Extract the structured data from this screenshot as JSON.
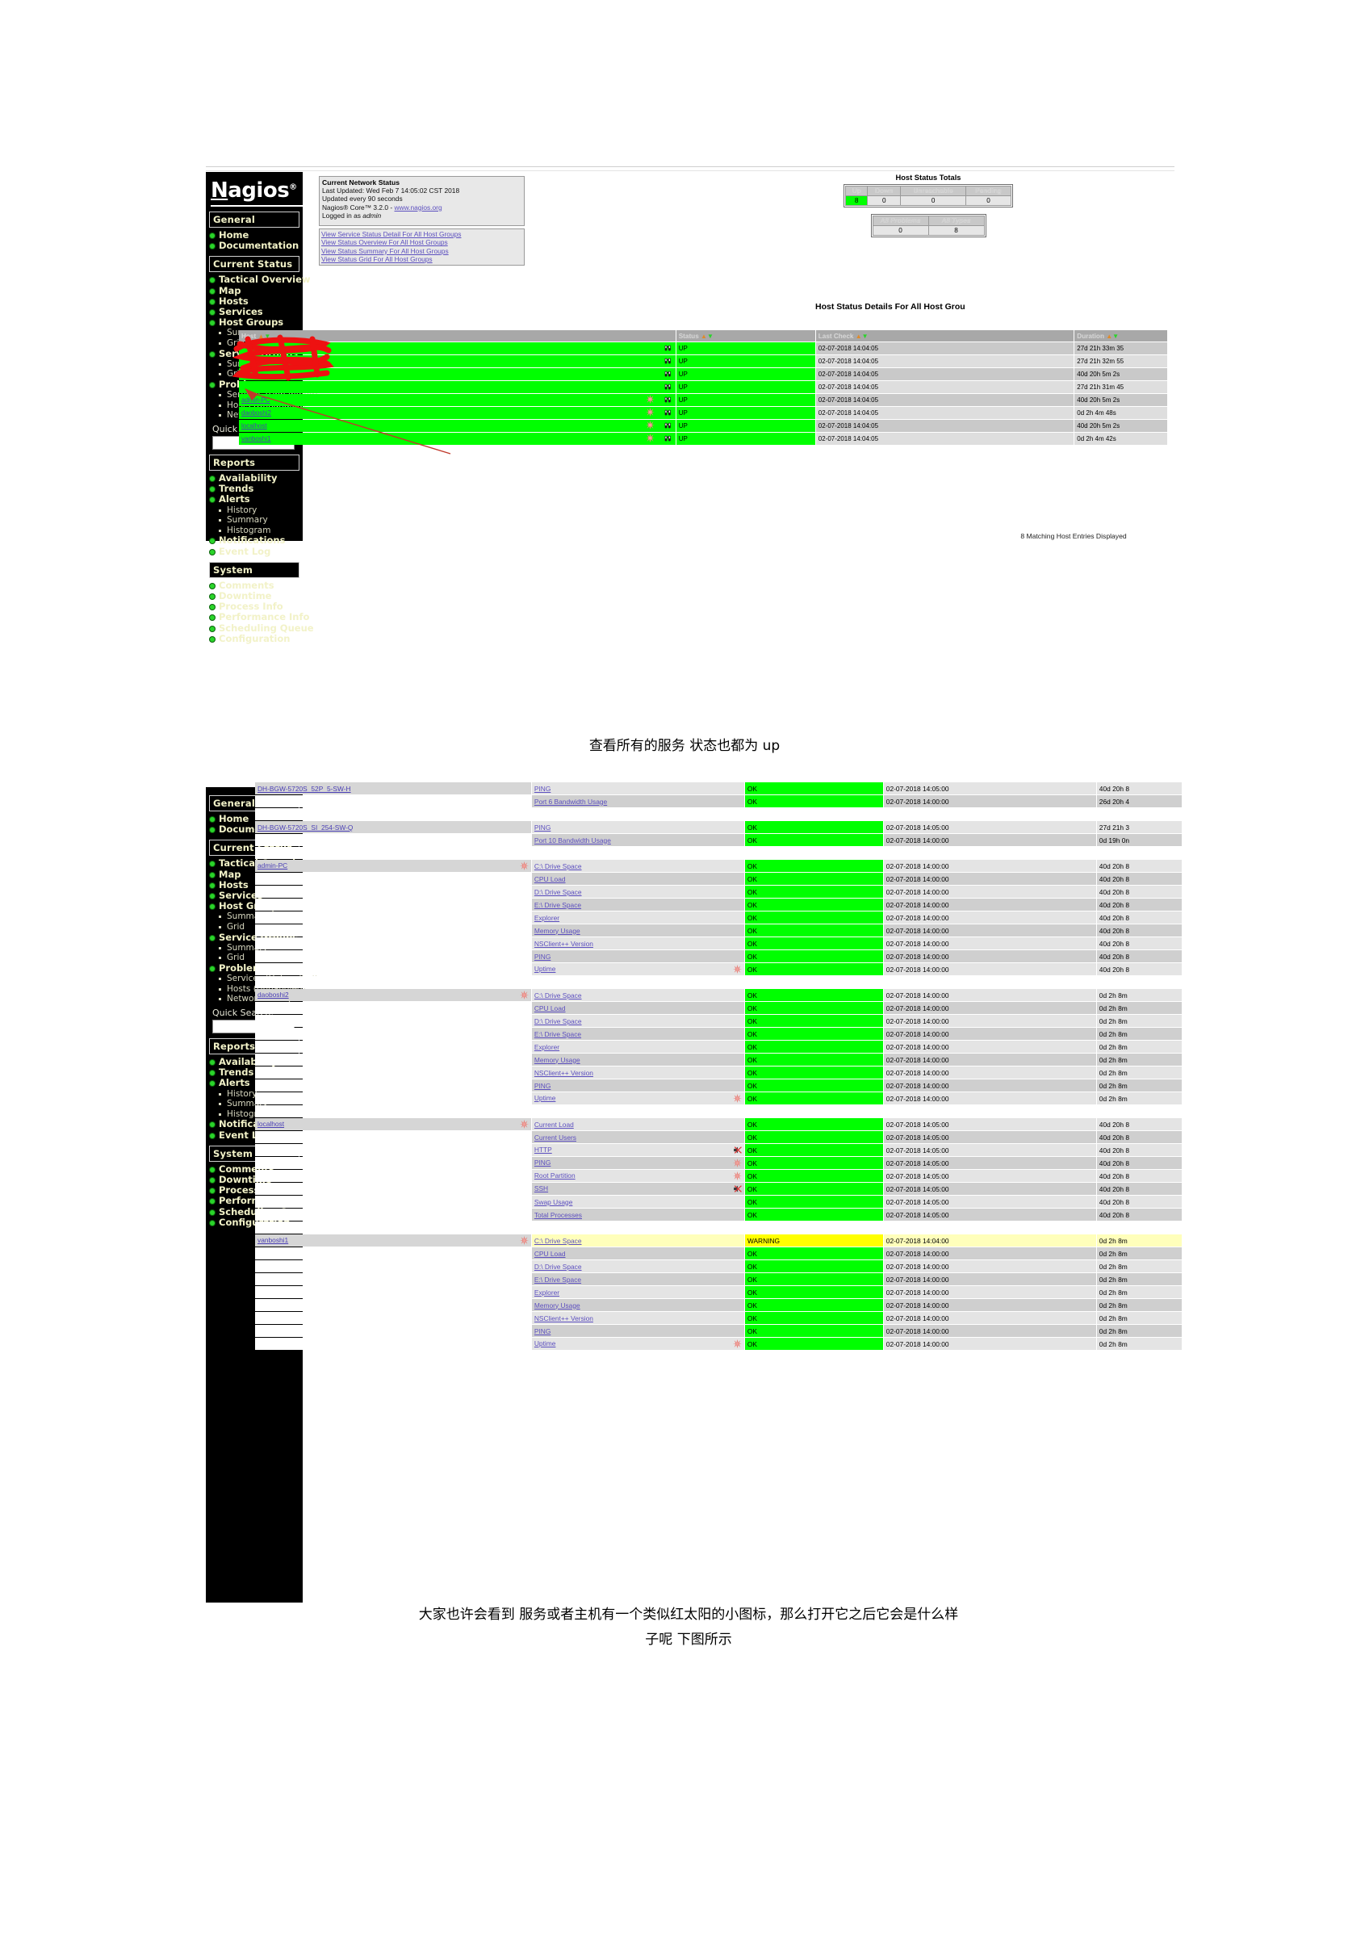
{
  "page": {
    "caption_mid": "查看所有的服务  状态也都为 up",
    "caption_bottom_line1": "大家也许会看到  服务或者主机有一个类似红太阳的小图标，那么打开它之后它会是什么样",
    "caption_bottom_line2": "子呢  下图所示"
  },
  "brand": {
    "logo_first": "N",
    "logo_rest": "agios",
    "logo_reg": "®"
  },
  "sidebar": {
    "sections": [
      {
        "title": "General",
        "items": [
          {
            "label": "Home",
            "children": []
          },
          {
            "label": "Documentation",
            "children": []
          }
        ]
      },
      {
        "title": "Current Status",
        "items": [
          {
            "label": "Tactical Overview",
            "children": []
          },
          {
            "label": "Map",
            "children": []
          },
          {
            "label": "Hosts",
            "children": []
          },
          {
            "label": "Services",
            "children": []
          },
          {
            "label": "Host Groups",
            "children": [
              "Summary",
              "Grid"
            ]
          },
          {
            "label": "Service Groups",
            "children": [
              "Summary",
              "Grid"
            ]
          },
          {
            "label": "Problems",
            "children": [
              "Services (Unhandled)",
              "Hosts (Unhandled)",
              "Network Outages"
            ]
          }
        ],
        "quick_search_label": "Quick Search:",
        "quick_search_value": ""
      },
      {
        "title": "Reports",
        "items": [
          {
            "label": "Availability",
            "children": []
          },
          {
            "label": "Trends",
            "children": []
          },
          {
            "label": "Alerts",
            "children": [
              "History",
              "Summary",
              "Histogram"
            ]
          },
          {
            "label": "Notifications",
            "children": []
          },
          {
            "label": "Event Log",
            "children": []
          }
        ]
      },
      {
        "title": "System",
        "items": [
          {
            "label": "Comments",
            "children": []
          },
          {
            "label": "Downtime",
            "children": []
          },
          {
            "label": "Process Info",
            "children": []
          },
          {
            "label": "Performance Info",
            "children": []
          },
          {
            "label": "Scheduling Queue",
            "children": []
          },
          {
            "label": "Configuration",
            "children": []
          }
        ]
      }
    ]
  },
  "network_status": {
    "title": "Current Network Status",
    "last_updated": "Last Updated: Wed Feb 7 14:05:02 CST 2018",
    "update_interval": "Updated every 90 seconds",
    "version_prefix": "Nagios® Core™ 3.2.0 - ",
    "version_link": "www.nagios.org",
    "logged_in": "Logged in as ",
    "logged_in_user": "admin",
    "links": [
      "View Service Status Detail For All Host Groups",
      "View Status Overview For All Host Groups",
      "View Status Summary For All Host Groups",
      "View Status Grid For All Host Groups"
    ]
  },
  "host_totals": {
    "title": "Host Status Totals",
    "headers": [
      "Up",
      "Down",
      "Unreachable",
      "Pending"
    ],
    "values": [
      "8",
      "0",
      "0",
      "0"
    ],
    "summary_headers": [
      "All Problems",
      "All Types"
    ],
    "summary_values": [
      "0",
      "8"
    ]
  },
  "host_details": {
    "title": "Host Status Details For All Host Grou",
    "columns": [
      "Host",
      "Status",
      "Last Check",
      "Duration"
    ],
    "rows": [
      {
        "host": "",
        "redacted": true,
        "status": "UP",
        "last_check": "02-07-2018 14:04:05",
        "duration": "27d 21h 33m 35",
        "sun": false
      },
      {
        "host": "",
        "redacted": true,
        "status": "UP",
        "last_check": "02-07-2018 14:04:05",
        "duration": "27d 21h 32m 55",
        "sun": false
      },
      {
        "host": "",
        "redacted": true,
        "status": "UP",
        "last_check": "02-07-2018 14:04:05",
        "duration": "40d 20h 5m 2s",
        "sun": false
      },
      {
        "host": "",
        "redacted": true,
        "status": "UP",
        "last_check": "02-07-2018 14:04:05",
        "duration": "27d 21h 31m 45",
        "sun": false
      },
      {
        "host": "admin-PC",
        "redacted": false,
        "status": "UP",
        "last_check": "02-07-2018 14:04:05",
        "duration": "40d 20h 5m 2s",
        "sun": true
      },
      {
        "host": "daoboshi2",
        "redacted": false,
        "status": "UP",
        "last_check": "02-07-2018 14:04:05",
        "duration": "0d 2h 4m 48s",
        "sun": true
      },
      {
        "host": "localhost",
        "redacted": false,
        "status": "UP",
        "last_check": "02-07-2018 14:04:05",
        "duration": "40d 20h 5m 2s",
        "sun": true
      },
      {
        "host": "vanboshi1",
        "redacted": false,
        "status": "UP",
        "last_check": "02-07-2018 14:04:05",
        "duration": "0d 2h 4m 42s",
        "sun": true
      }
    ],
    "footer": "8 Matching Host Entries Displayed"
  },
  "service_details": {
    "groups": [
      {
        "host": "DH-BGW-5720S_52P_5-SW-H",
        "host_sun": false,
        "partial_top": true,
        "services": [
          {
            "name": "PING",
            "status": "OK",
            "last_check": "02-07-2018 14:05:00",
            "duration": "40d 20h 8",
            "icon": ""
          },
          {
            "name": "Port 6 Bandwidth Usage",
            "status": "OK",
            "last_check": "02-07-2018 14:00:00",
            "duration": "26d 20h 4",
            "icon": ""
          }
        ]
      },
      {
        "host": "DH-BGW-5720S_SI_254-SW-Q",
        "host_sun": false,
        "partial_top": false,
        "services": [
          {
            "name": "PING",
            "status": "OK",
            "last_check": "02-07-2018 14:05:00",
            "duration": "27d 21h 3",
            "icon": ""
          },
          {
            "name": "Port 10 Bandwidth Usage",
            "status": "OK",
            "last_check": "02-07-2018 14:00:00",
            "duration": "0d 19h 0n",
            "icon": ""
          }
        ]
      },
      {
        "host": "admin-PC",
        "host_sun": true,
        "partial_top": false,
        "services": [
          {
            "name": "C:\\ Drive Space",
            "status": "OK",
            "last_check": "02-07-2018 14:00:00",
            "duration": "40d 20h 8",
            "icon": ""
          },
          {
            "name": "CPU Load",
            "status": "OK",
            "last_check": "02-07-2018 14:00:00",
            "duration": "40d 20h 8",
            "icon": ""
          },
          {
            "name": "D:\\ Drive Space",
            "status": "OK",
            "last_check": "02-07-2018 14:00:00",
            "duration": "40d 20h 8",
            "icon": ""
          },
          {
            "name": "E:\\ Drive Space",
            "status": "OK",
            "last_check": "02-07-2018 14:00:00",
            "duration": "40d 20h 8",
            "icon": ""
          },
          {
            "name": "Explorer",
            "status": "OK",
            "last_check": "02-07-2018 14:00:00",
            "duration": "40d 20h 8",
            "icon": ""
          },
          {
            "name": "Memory Usage",
            "status": "OK",
            "last_check": "02-07-2018 14:00:00",
            "duration": "40d 20h 8",
            "icon": ""
          },
          {
            "name": "NSClient++ Version",
            "status": "OK",
            "last_check": "02-07-2018 14:00:00",
            "duration": "40d 20h 8",
            "icon": ""
          },
          {
            "name": "PING",
            "status": "OK",
            "last_check": "02-07-2018 14:00:00",
            "duration": "40d 20h 8",
            "icon": ""
          },
          {
            "name": "Uptime",
            "status": "OK",
            "last_check": "02-07-2018 14:00:00",
            "duration": "40d 20h 8",
            "icon": "sun"
          }
        ]
      },
      {
        "host": "daoboshi2",
        "host_sun": true,
        "partial_top": false,
        "services": [
          {
            "name": "C:\\ Drive Space",
            "status": "OK",
            "last_check": "02-07-2018 14:00:00",
            "duration": "0d 2h 8m",
            "icon": ""
          },
          {
            "name": "CPU Load",
            "status": "OK",
            "last_check": "02-07-2018 14:00:00",
            "duration": "0d 2h 8m",
            "icon": ""
          },
          {
            "name": "D:\\ Drive Space",
            "status": "OK",
            "last_check": "02-07-2018 14:00:00",
            "duration": "0d 2h 8m",
            "icon": ""
          },
          {
            "name": "E:\\ Drive Space",
            "status": "OK",
            "last_check": "02-07-2018 14:00:00",
            "duration": "0d 2h 8m",
            "icon": ""
          },
          {
            "name": "Explorer",
            "status": "OK",
            "last_check": "02-07-2018 14:00:00",
            "duration": "0d 2h 8m",
            "icon": ""
          },
          {
            "name": "Memory Usage",
            "status": "OK",
            "last_check": "02-07-2018 14:00:00",
            "duration": "0d 2h 8m",
            "icon": ""
          },
          {
            "name": "NSClient++ Version",
            "status": "OK",
            "last_check": "02-07-2018 14:00:00",
            "duration": "0d 2h 8m",
            "icon": ""
          },
          {
            "name": "PING",
            "status": "OK",
            "last_check": "02-07-2018 14:00:00",
            "duration": "0d 2h 8m",
            "icon": ""
          },
          {
            "name": "Uptime",
            "status": "OK",
            "last_check": "02-07-2018 14:00:00",
            "duration": "0d 2h 8m",
            "icon": "sun"
          }
        ]
      },
      {
        "host": "localhost",
        "host_sun": true,
        "partial_top": false,
        "services": [
          {
            "name": "Current Load",
            "status": "OK",
            "last_check": "02-07-2018 14:05:00",
            "duration": "40d 20h 8",
            "icon": ""
          },
          {
            "name": "Current Users",
            "status": "OK",
            "last_check": "02-07-2018 14:05:00",
            "duration": "40d 20h 8",
            "icon": ""
          },
          {
            "name": "HTTP",
            "status": "OK",
            "last_check": "02-07-2018 14:05:00",
            "duration": "40d 20h 8",
            "icon": "muted"
          },
          {
            "name": "PING",
            "status": "OK",
            "last_check": "02-07-2018 14:05:00",
            "duration": "40d 20h 8",
            "icon": "sun"
          },
          {
            "name": "Root Partition",
            "status": "OK",
            "last_check": "02-07-2018 14:05:00",
            "duration": "40d 20h 8",
            "icon": "sun"
          },
          {
            "name": "SSH",
            "status": "OK",
            "last_check": "02-07-2018 14:05:00",
            "duration": "40d 20h 8",
            "icon": "muted"
          },
          {
            "name": "Swap Usage",
            "status": "OK",
            "last_check": "02-07-2018 14:05:00",
            "duration": "40d 20h 8",
            "icon": ""
          },
          {
            "name": "Total Processes",
            "status": "OK",
            "last_check": "02-07-2018 14:05:00",
            "duration": "40d 20h 8",
            "icon": ""
          }
        ]
      },
      {
        "host": "vanboshi1",
        "host_sun": true,
        "partial_top": false,
        "services": [
          {
            "name": "C:\\ Drive Space",
            "status": "WARNING",
            "last_check": "02-07-2018 14:04:00",
            "duration": "0d 2h 8m",
            "icon": ""
          },
          {
            "name": "CPU Load",
            "status": "OK",
            "last_check": "02-07-2018 14:00:00",
            "duration": "0d 2h 8m",
            "icon": ""
          },
          {
            "name": "D:\\ Drive Space",
            "status": "OK",
            "last_check": "02-07-2018 14:00:00",
            "duration": "0d 2h 8m",
            "icon": ""
          },
          {
            "name": "E:\\ Drive Space",
            "status": "OK",
            "last_check": "02-07-2018 14:00:00",
            "duration": "0d 2h 8m",
            "icon": ""
          },
          {
            "name": "Explorer",
            "status": "OK",
            "last_check": "02-07-2018 14:00:00",
            "duration": "0d 2h 8m",
            "icon": ""
          },
          {
            "name": "Memory Usage",
            "status": "OK",
            "last_check": "02-07-2018 14:00:00",
            "duration": "0d 2h 8m",
            "icon": ""
          },
          {
            "name": "NSClient++ Version",
            "status": "OK",
            "last_check": "02-07-2018 14:00:00",
            "duration": "0d 2h 8m",
            "icon": ""
          },
          {
            "name": "PING",
            "status": "OK",
            "last_check": "02-07-2018 14:00:00",
            "duration": "0d 2h 8m",
            "icon": ""
          },
          {
            "name": "Uptime",
            "status": "OK",
            "last_check": "02-07-2018 14:00:00",
            "duration": "0d 2h 8m",
            "icon": "sun"
          }
        ]
      }
    ]
  }
}
